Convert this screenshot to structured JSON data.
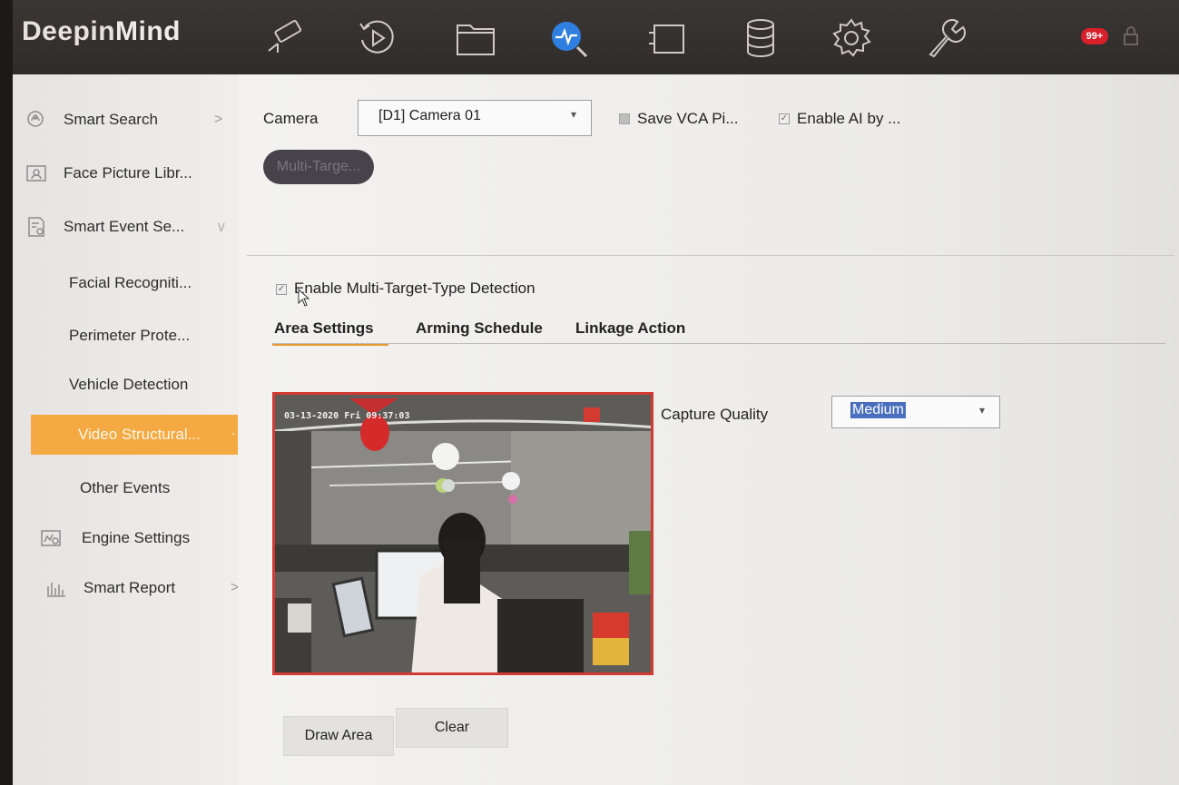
{
  "app": {
    "brand_part1": "Deepin",
    "brand_part2": "Mind",
    "notification_count": "99+"
  },
  "toolbar": {
    "icons": [
      "camera-icon",
      "playback-icon",
      "file-icon",
      "smart-search-icon",
      "monitor-icon",
      "storage-icon",
      "settings-icon",
      "maintenance-icon"
    ],
    "active_icon": "smart-search-icon",
    "active_color": "#2f7fe0"
  },
  "sidebar": {
    "items": [
      {
        "label": "Smart Search",
        "icon": "smart-search-icon",
        "chevron": ">"
      },
      {
        "label": "Face Picture Libr...",
        "icon": "face-picture-icon"
      },
      {
        "label": "Smart Event Se...",
        "icon": "smart-event-icon",
        "chevron": "∨"
      },
      {
        "label": "Facial Recogniti..."
      },
      {
        "label": "Perimeter Prote..."
      },
      {
        "label": "Vehicle Detection"
      },
      {
        "label": "Video Structural...",
        "active": true,
        "chevron": "·"
      },
      {
        "label": "Other Events"
      },
      {
        "label": "Engine Settings",
        "icon": "engine-settings-icon"
      },
      {
        "label": "Smart Report",
        "icon": "smart-report-icon",
        "chevron": ">"
      }
    ],
    "active_color": "#f4a942"
  },
  "main": {
    "camera_label": "Camera",
    "camera_value": "[D1] Camera 01",
    "save_vca_label": "Save VCA Pi...",
    "enable_ai_label": "Enable AI by ...",
    "multi_target_pill": "Multi-Targe...",
    "enable_detection_label": "Enable Multi-Target-Type Detection",
    "tabs": [
      {
        "label": "Area Settings",
        "active": true
      },
      {
        "label": "Arming Schedule"
      },
      {
        "label": "Linkage Action"
      }
    ],
    "osd_text": "03-13-2020 Fri 09:37:03",
    "capture_quality_label": "Capture Quality",
    "capture_quality_value": "Medium",
    "draw_area_label": "Draw Area",
    "clear_label": "Clear"
  }
}
